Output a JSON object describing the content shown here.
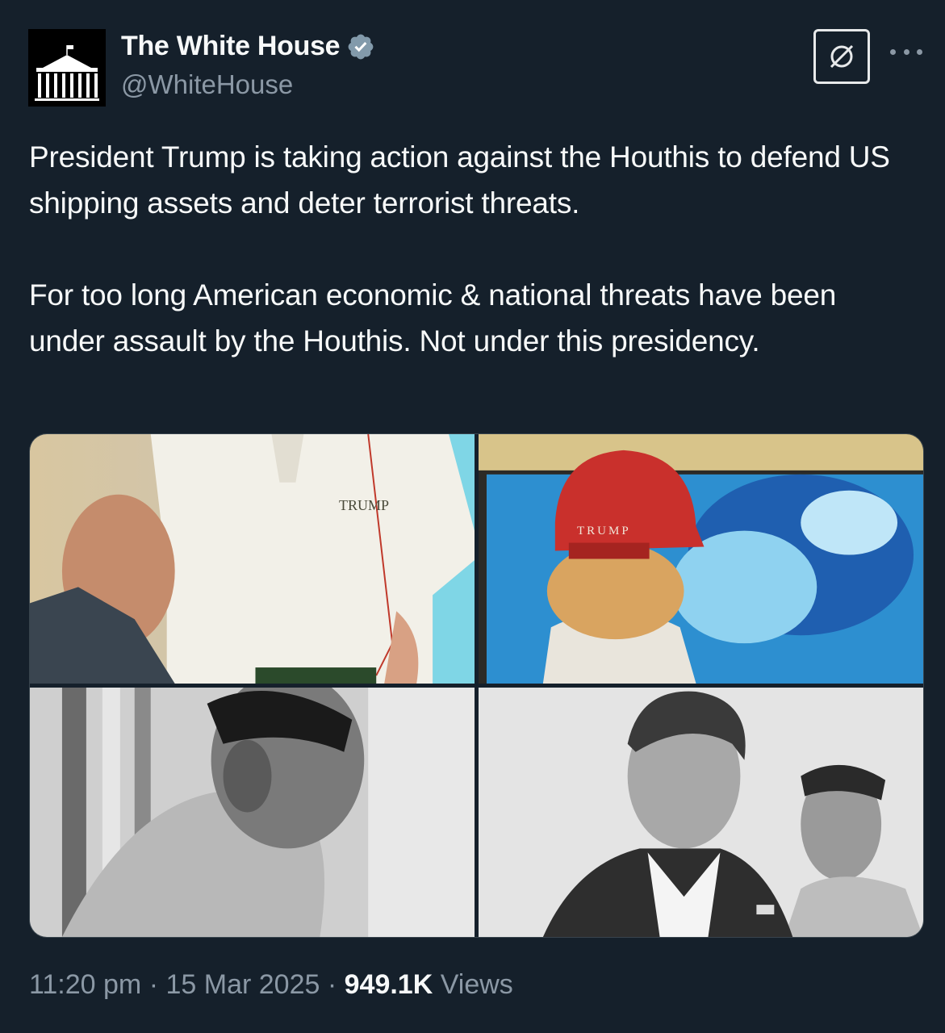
{
  "author": {
    "name": "The White House",
    "handle": "@WhiteHouse",
    "verified": true,
    "avatar_icon": "white-house-logo"
  },
  "tweet": {
    "paragraphs": [
      "President Trump is taking action against the Houthis to defend US shipping assets and deter terrorist threats.",
      "For too long American economic & national threats have been under assault by the Houthis. Not under this presidency."
    ]
  },
  "media": [
    {
      "id": "photo-1",
      "overlay_text": "TRUMP"
    },
    {
      "id": "photo-2",
      "overlay_text": "TRUMP"
    },
    {
      "id": "photo-3"
    },
    {
      "id": "photo-4"
    }
  ],
  "meta": {
    "time": "11:20 pm",
    "separator": "·",
    "date": "15 Mar 2025",
    "views_count": "949.1K",
    "views_label": "Views"
  },
  "colors": {
    "background": "#15202b",
    "secondary_text": "#8b98a5",
    "verified_badge": "#829aab"
  }
}
